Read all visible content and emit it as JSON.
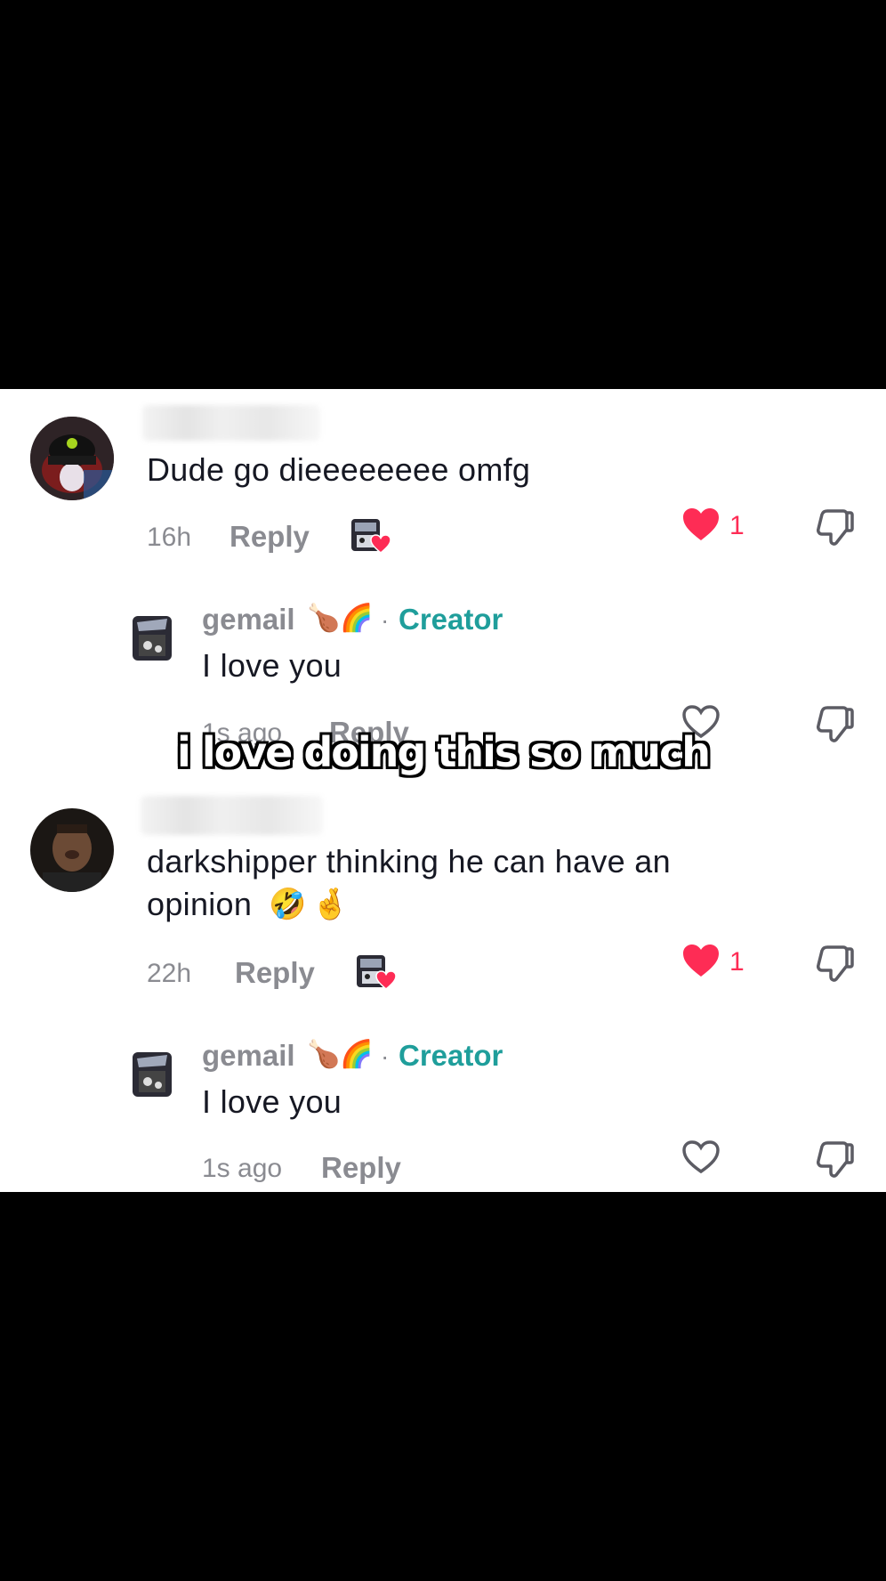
{
  "comments": [
    {
      "text": "Dude go dieeeeeeee omfg",
      "time": "16h",
      "reply_label": "Reply",
      "likes": "1",
      "liked_by_creator": true,
      "replies": [
        {
          "username": "gemail",
          "creator_label": "Creator",
          "separator": "·",
          "text": "I love you",
          "time": "1s ago",
          "reply_label": "Reply"
        }
      ]
    },
    {
      "text": "darkshipper thinking he can have an opinion🤣🤞",
      "text_line1": "darkshipper thinking he can have an",
      "text_line2": "opinion",
      "time": "22h",
      "reply_label": "Reply",
      "likes": "1",
      "liked_by_creator": true,
      "replies": [
        {
          "username": "gemail",
          "creator_label": "Creator",
          "separator": "·",
          "text": "I love you",
          "time": "1s ago",
          "reply_label": "Reply"
        }
      ]
    }
  ],
  "caption": "i love doing this so much",
  "colors": {
    "like_red": "#fe2c55",
    "creator_teal": "#1f9e9b",
    "meta_gray": "#8a8b91"
  },
  "icons": [
    "heart-icon",
    "heart-outline-icon",
    "dislike-icon"
  ]
}
